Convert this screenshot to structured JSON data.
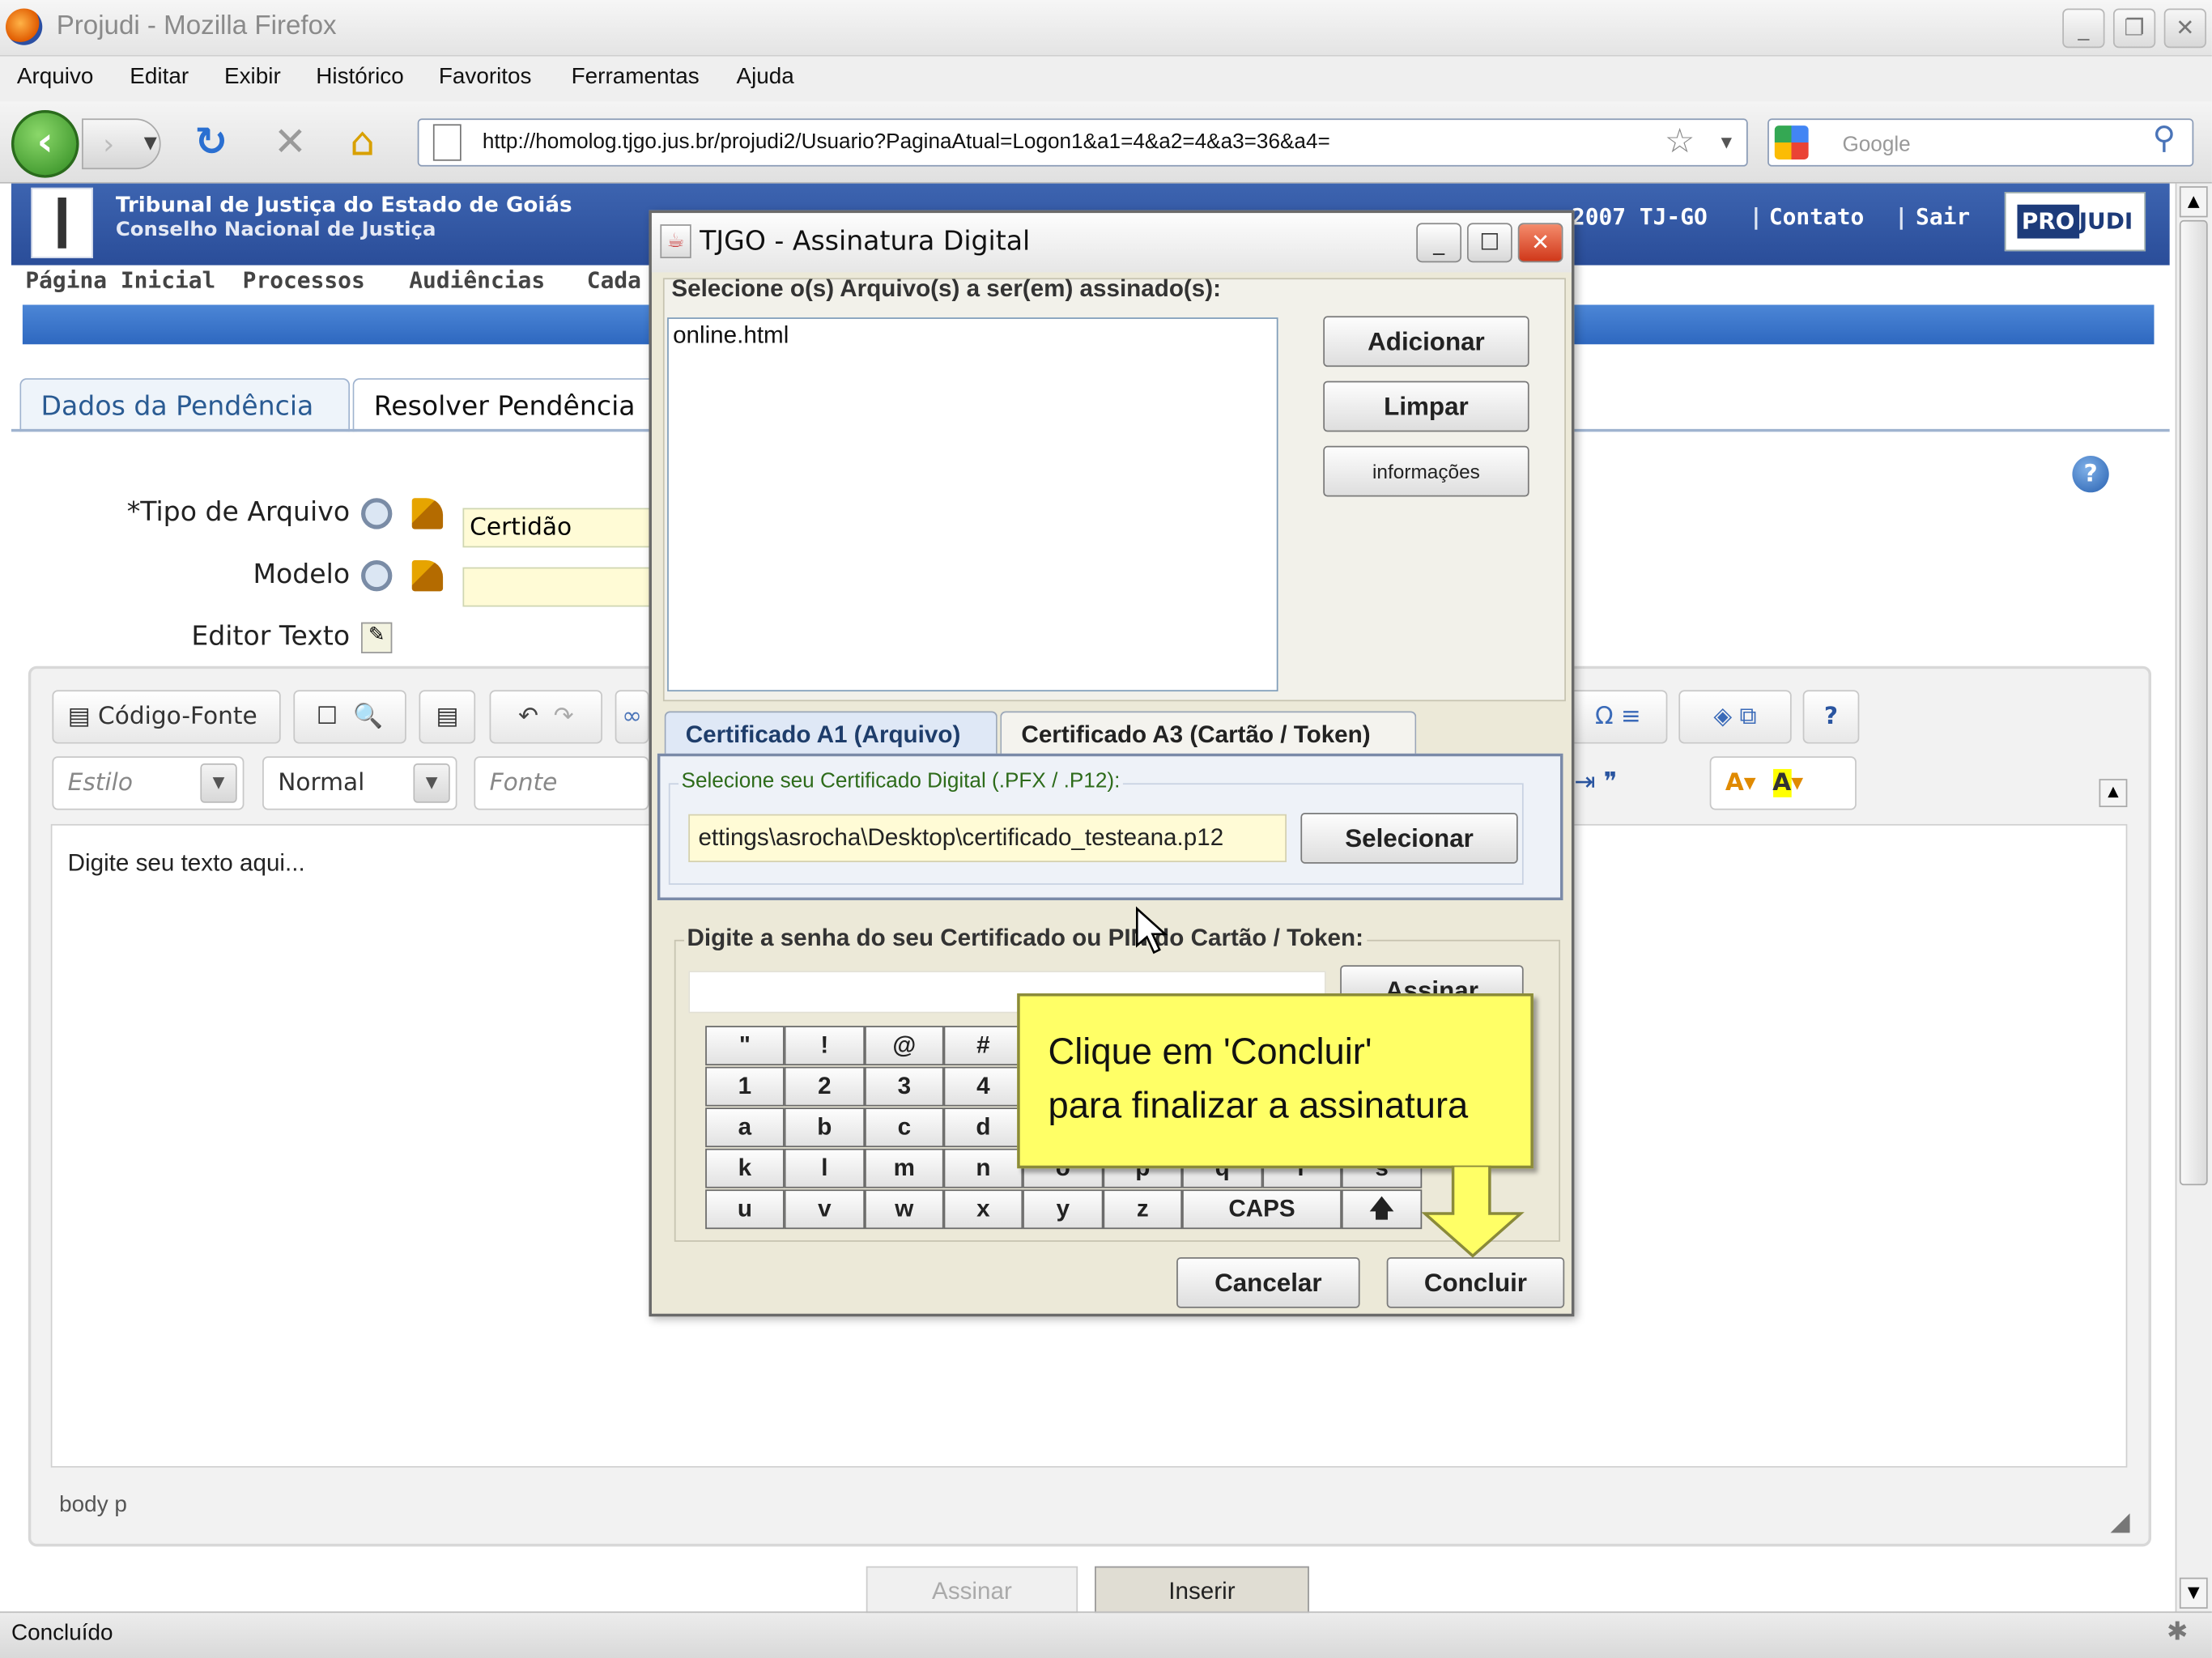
{
  "browser": {
    "window_title": "Projudi - Mozilla Firefox",
    "menu": [
      "Arquivo",
      "Editar",
      "Exibir",
      "Histórico",
      "Favoritos",
      "Ferramentas",
      "Ajuda"
    ],
    "url": "http://homolog.tjgo.jus.br/projudi2/Usuario?PaginaAtual=Logon1&a1=4&a2=4&a3=36&a4=",
    "search_placeholder": "Google",
    "status": "Concluído"
  },
  "site": {
    "org_line1": "Tribunal de Justiça do Estado de Goiás",
    "org_line2": "Conselho Nacional de Justiça",
    "copyright_tail": "2007 TJ-GO",
    "link_contato": "Contato",
    "link_sair": "Sair",
    "logo_text_pro": "PRO",
    "logo_text_judi": "JUDI",
    "nav": [
      "Página Inicial",
      "Processos",
      "Audiências",
      "Cada"
    ]
  },
  "page": {
    "tabs": [
      "Dados da Pendência",
      "Resolver Pendência"
    ],
    "field_tipo_label": "*Tipo de Arquivo",
    "field_tipo_value": "Certidão",
    "field_modelo_label": "Modelo",
    "field_editor_label": "Editor Texto",
    "editor": {
      "source_btn": "Código-Fonte",
      "style_combo": "Estilo",
      "format_combo": "Normal",
      "font_combo": "Fonte",
      "placeholder": "Digite seu texto aqui...",
      "path": "body  p"
    },
    "btn_assinar": "Assinar",
    "btn_inserir": "Inserir"
  },
  "dialog": {
    "title": "TJGO - Assinatura Digital",
    "files_label": "Selecione o(s) Arquivo(s) a ser(em) assinado(s):",
    "files": [
      "online.html"
    ],
    "btn_adicionar": "Adicionar",
    "btn_limpar": "Limpar",
    "btn_informacoes": "informações",
    "tab_a1": "Certificado A1 (Arquivo)",
    "tab_a3": "Certificado A3 (Cartão / Token)",
    "cert_label": "Selecione seu Certificado Digital (.PFX / .P12):",
    "cert_path": "ettings\\asrocha\\Desktop\\certificado_testeana.p12",
    "btn_selecionar": "Selecionar",
    "password_label": "Digite a senha do seu Certificado ou PIN do Cartão / Token:",
    "btn_assinar": "Assinar",
    "keys_row1": [
      "\"",
      "!",
      "@",
      "#"
    ],
    "keys_row2": [
      "1",
      "2",
      "3",
      "4"
    ],
    "keys_row3": [
      "a",
      "b",
      "c",
      "d"
    ],
    "keys_row4": [
      "k",
      "l",
      "m",
      "n",
      "o",
      "p",
      "q",
      "r",
      "s"
    ],
    "keys_row5": [
      "u",
      "v",
      "w",
      "x",
      "y",
      "z",
      "CAPS",
      "🡅"
    ],
    "btn_cancelar": "Cancelar",
    "btn_concluir": "Concluir"
  },
  "tooltip": {
    "line1": "Clique em 'Concluir'",
    "line2": "para finalizar a assinatura"
  }
}
